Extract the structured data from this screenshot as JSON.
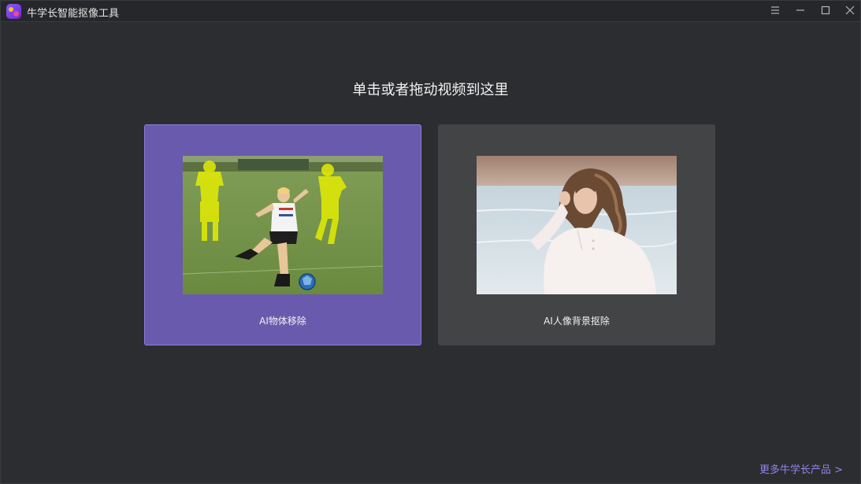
{
  "window": {
    "title": "牛学长智能抠像工具",
    "controls": {
      "menu_icon": "menu-icon",
      "minimize_icon": "minimize-icon",
      "maximize_icon": "maximize-icon",
      "close_icon": "close-icon"
    }
  },
  "main": {
    "prompt": "单击或者拖动视频到这里",
    "cards": [
      {
        "label": "AI物体移除",
        "selected": true,
        "image": "soccer-kids-object-removal-preview"
      },
      {
        "label": "AI人像背景抠除",
        "selected": false,
        "image": "portrait-woman-beach-preview"
      }
    ]
  },
  "footer": {
    "more_products": "更多牛学长产品 >"
  },
  "colors": {
    "background": "#2c2d30",
    "titlebar": "#26272a",
    "card_active": "#6a5aad",
    "card_active_border": "#8b7de0",
    "card_inactive": "#434446",
    "link": "#8f84e8",
    "highlight_overlay": "#e8f000"
  }
}
